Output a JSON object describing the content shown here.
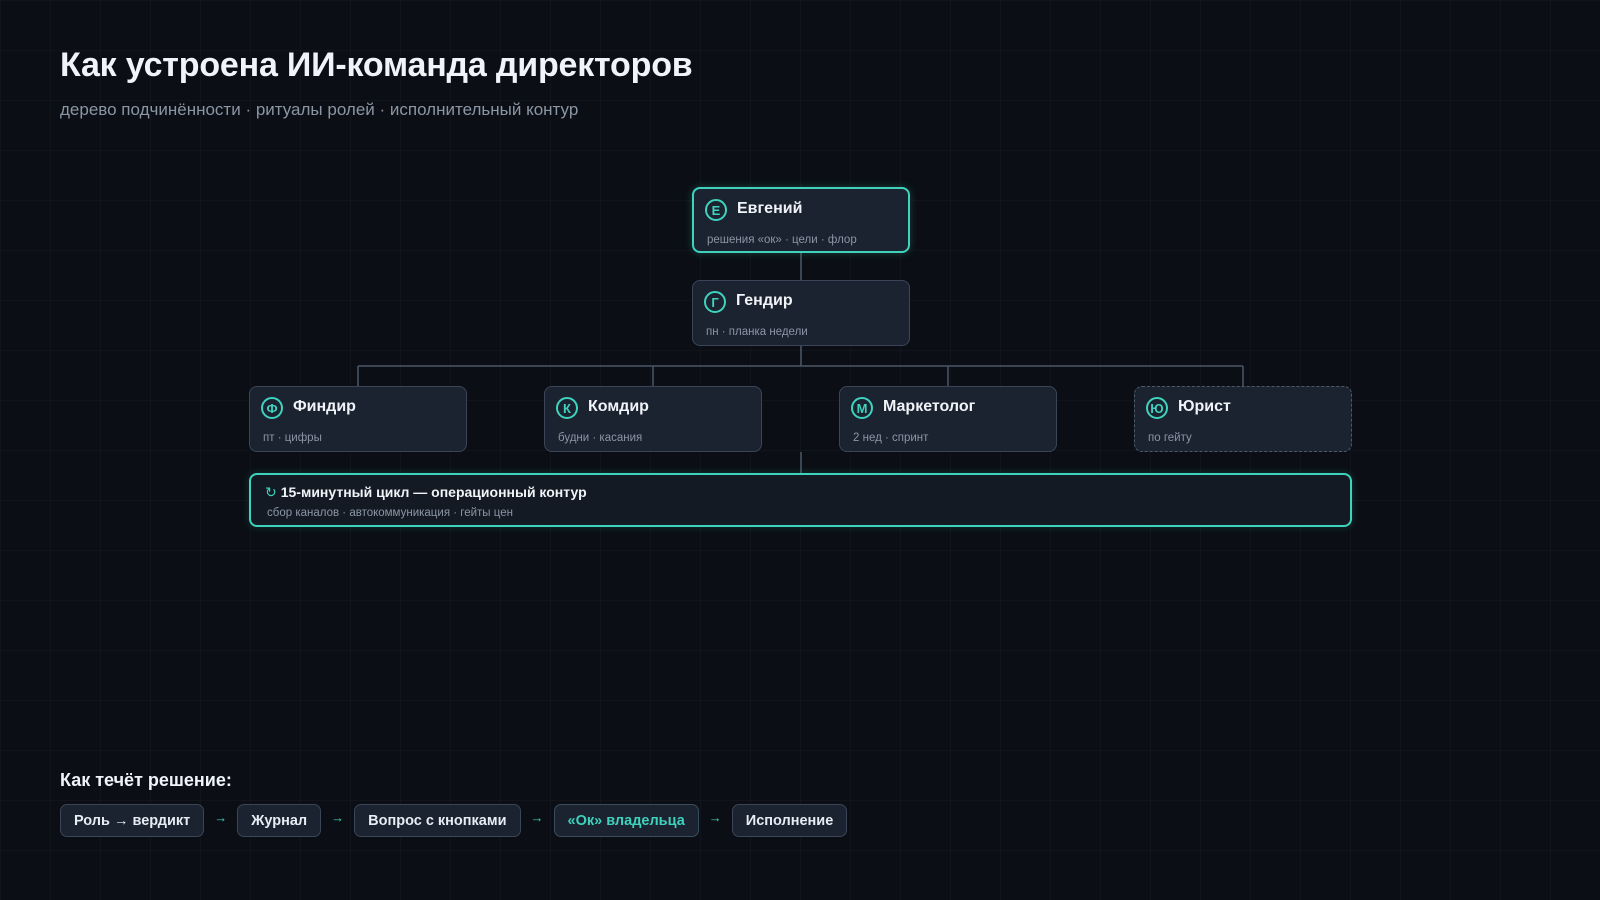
{
  "header": {
    "title": "Как устроена ИИ-команда директоров",
    "subtitle": "дерево подчинённости · ритуалы ролей · исполнительный контур"
  },
  "tree": {
    "owner": {
      "initial": "Е",
      "name": "Евгений",
      "sub": "решения «ок» · цели · флор"
    },
    "ceo": {
      "initial": "Г",
      "name": "Гендир",
      "sub": "пн · планка недели"
    },
    "directors": [
      {
        "initial": "Ф",
        "name": "Финдир",
        "sub": "пт · цифры"
      },
      {
        "initial": "К",
        "name": "Комдир",
        "sub": "будни · касания"
      },
      {
        "initial": "М",
        "name": "Маркетолог",
        "sub": "2 нед · спринт"
      },
      {
        "initial": "Ю",
        "name": "Юрист",
        "sub": "по гейту"
      }
    ]
  },
  "loop": {
    "icon": "↻",
    "title": "15-минутный цикл — операционный контур",
    "sub": "сбор каналов · автокоммуникация · гейты цен"
  },
  "flow": {
    "label": "Как течёт решение:",
    "steps": [
      {
        "label": "Роль → вердикт"
      },
      {
        "label": "Журнал"
      },
      {
        "label": "Вопрос с кнопками"
      },
      {
        "label": "«Ок» владельца"
      },
      {
        "label": "Исполнение"
      }
    ],
    "arrow": "→"
  },
  "colors": {
    "accent": "#3fd2bd",
    "background": "#0b0f15",
    "card": "#1b2230",
    "border": "#3a4658",
    "muted": "#8b96a5"
  }
}
